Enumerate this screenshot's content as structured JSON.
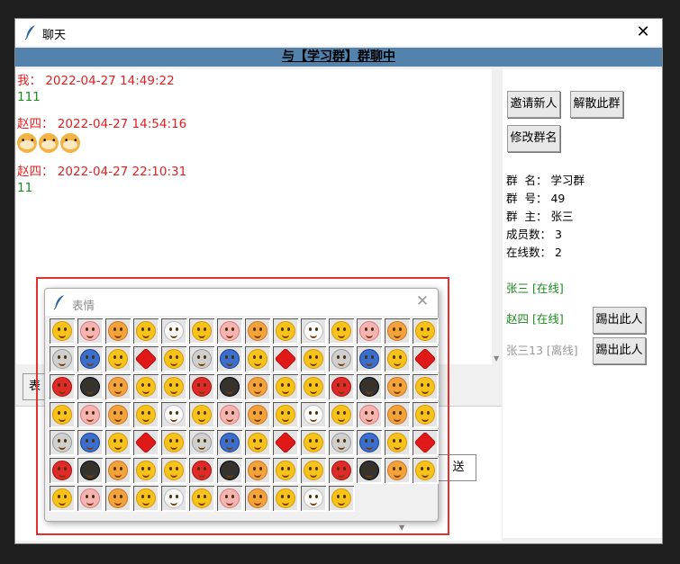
{
  "window": {
    "title": "聊天",
    "close_icon": "✕"
  },
  "header": {
    "title": "与【学习群】群聊中"
  },
  "messages": [
    {
      "sender": "我：",
      "time": "2022-04-27 14:49:22",
      "text": "111",
      "emoji_count": 0
    },
    {
      "sender": "赵四：",
      "time": "2022-04-27 14:54:16",
      "text": "",
      "emoji_count": 3
    },
    {
      "sender": "赵四：",
      "time": "2022-04-27 22:10:31",
      "text": "11",
      "emoji_count": 0
    }
  ],
  "input": {
    "emoji_button_label": "表",
    "send_button_label": "送"
  },
  "sidebar": {
    "invite_label": "邀请新人",
    "dissolve_label": "解散此群",
    "rename_label": "修改群名",
    "info": [
      {
        "label": "群  名：",
        "value": "学习群"
      },
      {
        "label": "群  号：",
        "value": "49"
      },
      {
        "label": "群  主：",
        "value": "张三"
      },
      {
        "label": "成员数：",
        "value": "3"
      },
      {
        "label": "在线数：",
        "value": "2"
      }
    ],
    "members": [
      {
        "name": "张三 [在线]",
        "status": "online",
        "kick_label": ""
      },
      {
        "name": "赵四 [在线]",
        "status": "online",
        "kick_label": "踢出此人"
      },
      {
        "name": "张三13 [离线]",
        "status": "offline",
        "kick_label": "踢出此人"
      }
    ]
  },
  "emoji_popup": {
    "title": "表情",
    "close_icon": "✕",
    "rows": 7,
    "columns": 14,
    "last_row_count": 11
  },
  "colors": {
    "header_bg": "#5382ad",
    "sender_time": "#e02020",
    "message_text": "#1a8a1a",
    "online": "#1a8a1a",
    "offline": "#999999",
    "highlight_box": "#e53030"
  }
}
